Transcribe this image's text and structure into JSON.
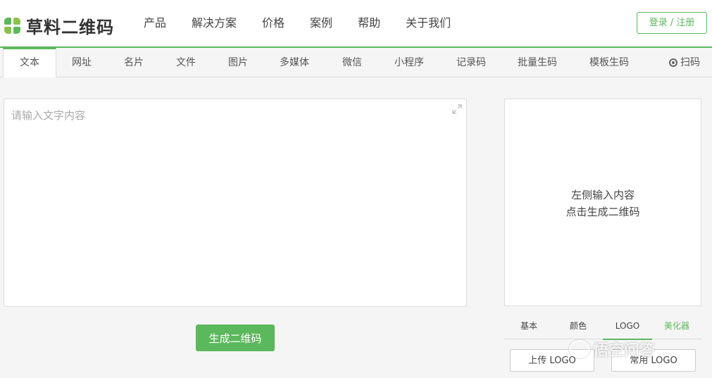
{
  "header": {
    "logo_text": "草料二维码",
    "nav": [
      "产品",
      "解决方案",
      "价格",
      "案例",
      "帮助",
      "关于我们"
    ],
    "login_label": "登录 / 注册"
  },
  "tabs": {
    "items": [
      "文本",
      "网址",
      "名片",
      "文件",
      "图片",
      "多媒体",
      "微信",
      "小程序",
      "记录码",
      "批量生码",
      "模板生码"
    ],
    "active": "文本",
    "scan_label": "扫码"
  },
  "editor": {
    "placeholder": "请输入文字内容",
    "value": "",
    "generate_label": "生成二维码"
  },
  "preview": {
    "line1": "左侧输入内容",
    "line2": "点击生成二维码"
  },
  "style_tabs": {
    "items": [
      "基本",
      "颜色",
      "LOGO",
      "美化器"
    ],
    "active": "LOGO"
  },
  "logo_buttons": {
    "upload": "上传 LOGO",
    "common": "常用 LOGO"
  },
  "watermark": "悟空问答",
  "colors": {
    "accent": "#5cb85c"
  }
}
